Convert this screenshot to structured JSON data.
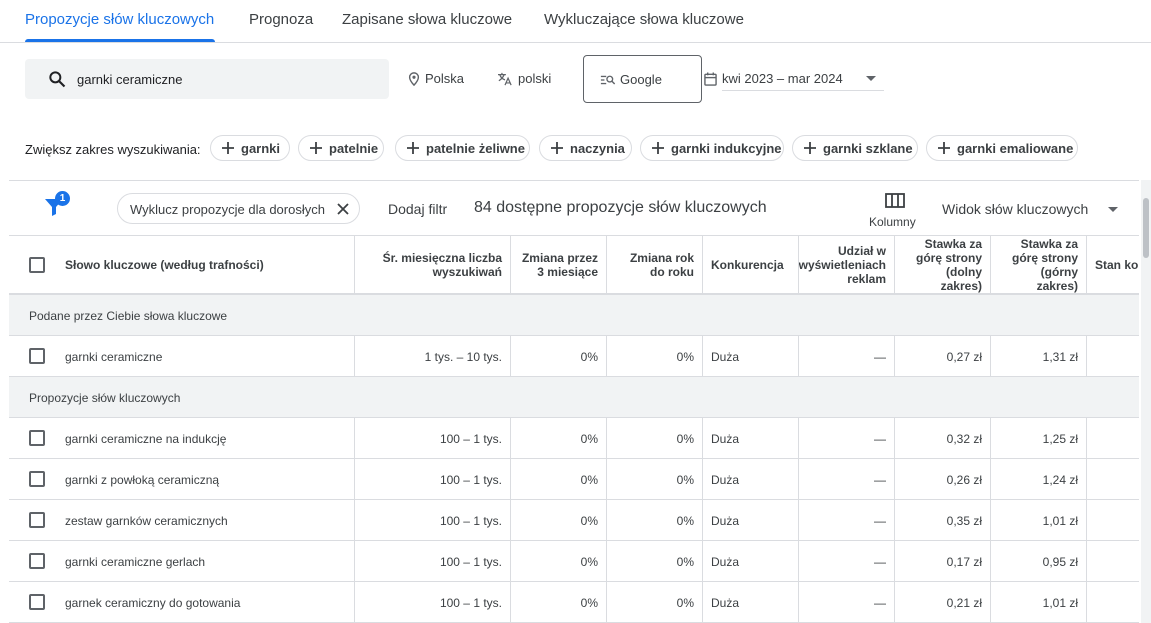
{
  "tabs": [
    {
      "label": "Propozycje słów kluczowych",
      "active": true
    },
    {
      "label": "Prognoza"
    },
    {
      "label": "Zapisane słowa kluczowe"
    },
    {
      "label": "Wykluczające słowa kluczowe"
    }
  ],
  "search": {
    "value": "garnki ceramiczne",
    "icon": "search-icon"
  },
  "targeting": {
    "location": "Polska",
    "language": "polski",
    "engine": "Google",
    "date_range": "kwi 2023 – mar 2024"
  },
  "expand": {
    "label": "Zwiększ zakres wyszukiwania:",
    "chips": [
      "garnki",
      "patelnie",
      "patelnie żeliwne",
      "naczynia",
      "garnki indukcyjne",
      "garnki szklane",
      "garnki emaliowane"
    ]
  },
  "filterbar": {
    "badge": "1",
    "exclude_chip": "Wyklucz propozycje dla dorosłych",
    "add_filter": "Dodaj filtr",
    "count_text": "84 dostępne propozycje słów kluczowych",
    "columns_label": "Kolumny",
    "view_label": "Widok słów kluczowych"
  },
  "table": {
    "headers": {
      "keyword": "Słowo kluczowe (według trafności)",
      "avg": "Śr. miesięczna liczba wyszukiwań",
      "change3": "Zmiana przez 3 miesiące",
      "yoy": "Zmiana rok do roku",
      "competition": "Konkurencja",
      "share": "Udział w wyświetleniach reklam",
      "bid_low": "Stawka za górę strony (dolny zakres)",
      "bid_high": "Stawka za górę strony (górny zakres)",
      "status": "Stan konta"
    },
    "group1_label": "Podane przez Ciebie słowa kluczowe",
    "group2_label": "Propozycje słów kluczowych",
    "given": [
      {
        "keyword": "garnki ceramiczne",
        "avg": "1 tys. – 10 tys.",
        "change3": "0%",
        "yoy": "0%",
        "competition": "Duża",
        "share": "—",
        "bid_low": "0,27 zł",
        "bid_high": "1,31 zł"
      }
    ],
    "ideas": [
      {
        "keyword": "garnki ceramiczne na indukcję",
        "avg": "100 – 1 tys.",
        "change3": "0%",
        "yoy": "0%",
        "competition": "Duża",
        "share": "—",
        "bid_low": "0,32 zł",
        "bid_high": "1,25 zł"
      },
      {
        "keyword": "garnki z powłoką ceramiczną",
        "avg": "100 – 1 tys.",
        "change3": "0%",
        "yoy": "0%",
        "competition": "Duża",
        "share": "—",
        "bid_low": "0,26 zł",
        "bid_high": "1,24 zł"
      },
      {
        "keyword": "zestaw garnków ceramicznych",
        "avg": "100 – 1 tys.",
        "change3": "0%",
        "yoy": "0%",
        "competition": "Duża",
        "share": "—",
        "bid_low": "0,35 zł",
        "bid_high": "1,01 zł"
      },
      {
        "keyword": "garnki ceramiczne gerlach",
        "avg": "100 – 1 tys.",
        "change3": "0%",
        "yoy": "0%",
        "competition": "Duża",
        "share": "—",
        "bid_low": "0,17 zł",
        "bid_high": "0,95 zł"
      },
      {
        "keyword": "garnek ceramiczny do gotowania",
        "avg": "100 – 1 tys.",
        "change3": "0%",
        "yoy": "0%",
        "competition": "Duża",
        "share": "—",
        "bid_low": "0,21 zł",
        "bid_high": "1,01 zł"
      }
    ]
  },
  "colors": {
    "accent": "#1a73e8",
    "border": "#dadce0",
    "group_bg": "#f1f3f4"
  }
}
